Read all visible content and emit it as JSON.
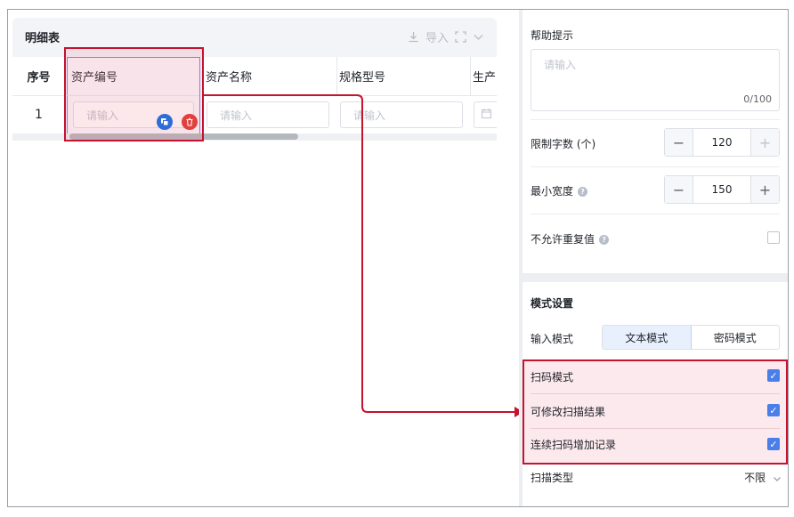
{
  "designer": {
    "detail_title": "明细表",
    "import_label": "导入",
    "columns": [
      "序号",
      "资产编号",
      "资产名称",
      "规格型号",
      "生产"
    ],
    "row_index": "1",
    "input_placeholder": "请输入"
  },
  "props": {
    "help_label": "帮助提示",
    "help_placeholder": "请输入",
    "help_counter": "0/100",
    "limit_label": "限制字数 (个)",
    "limit_value": "120",
    "min_width_label": "最小宽度",
    "min_width_value": "150",
    "no_dup_label": "不允许重复值",
    "mode_section_title": "模式设置",
    "input_mode_label": "输入模式",
    "text_mode": "文本模式",
    "password_mode": "密码模式",
    "scan_mode": "扫码模式",
    "editable_scan": "可修改扫描结果",
    "continuous_scan": "连续扫码增加记录",
    "scan_type_label": "扫描类型",
    "scan_type_value": "不限",
    "no_dup_checked": false,
    "scan_mode_checked": true,
    "editable_scan_checked": true,
    "continuous_scan_checked": true
  },
  "colors": {
    "highlight_red": "#c4122f",
    "accent_blue": "#4a7ee8"
  }
}
